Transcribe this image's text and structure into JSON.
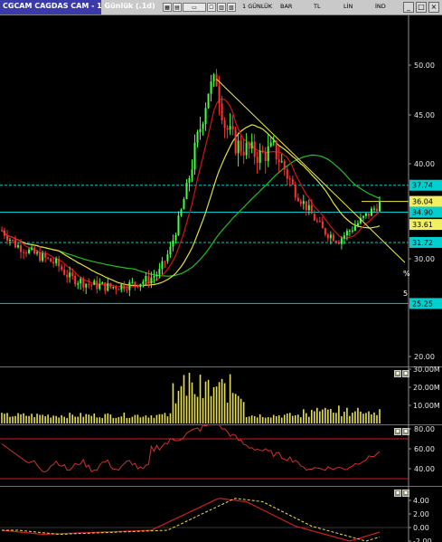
{
  "window": {
    "title": "CGCAM CAGDAS CAM - 1 Günlük (.1d)",
    "toolbar": {
      "interval": "1 GÜNLÜK",
      "chart_type": "BAR",
      "currency": "TL",
      "scale": "LİN",
      "indicators": "İND"
    }
  },
  "price_panel": {
    "axis_ticks": [
      "50.00",
      "45.00",
      "40.00",
      "30.00",
      "25.00",
      "20.00"
    ],
    "tags": [
      {
        "value": "37.74",
        "color": "#00d0d0"
      },
      {
        "value": "36.04",
        "color": "#f0f060"
      },
      {
        "value": "34.90",
        "color": "#00d0d0"
      },
      {
        "value": "33.61",
        "color": "#f0f060"
      },
      {
        "value": "31.72",
        "color": "#00d0d0"
      },
      {
        "value": "25.25",
        "color": "#00d0d0"
      }
    ],
    "small_marks": [
      "%",
      "5"
    ],
    "colors": {
      "up": "#44ff44",
      "down": "#ff3333",
      "ma_short": "#d01515",
      "ma_mid": "#e0e040",
      "ma_long": "#20c020",
      "trend": "#f0f040"
    }
  },
  "volume_panel": {
    "axis_ticks": [
      "30.00M",
      "20.00M",
      "10.00M"
    ]
  },
  "rsi_panel": {
    "axis_ticks": [
      "80.00",
      "60.00",
      "40.00"
    ]
  },
  "macd_panel": {
    "axis_ticks": [
      "4.00",
      "2.00",
      "0.00",
      "-2.00"
    ]
  }
}
